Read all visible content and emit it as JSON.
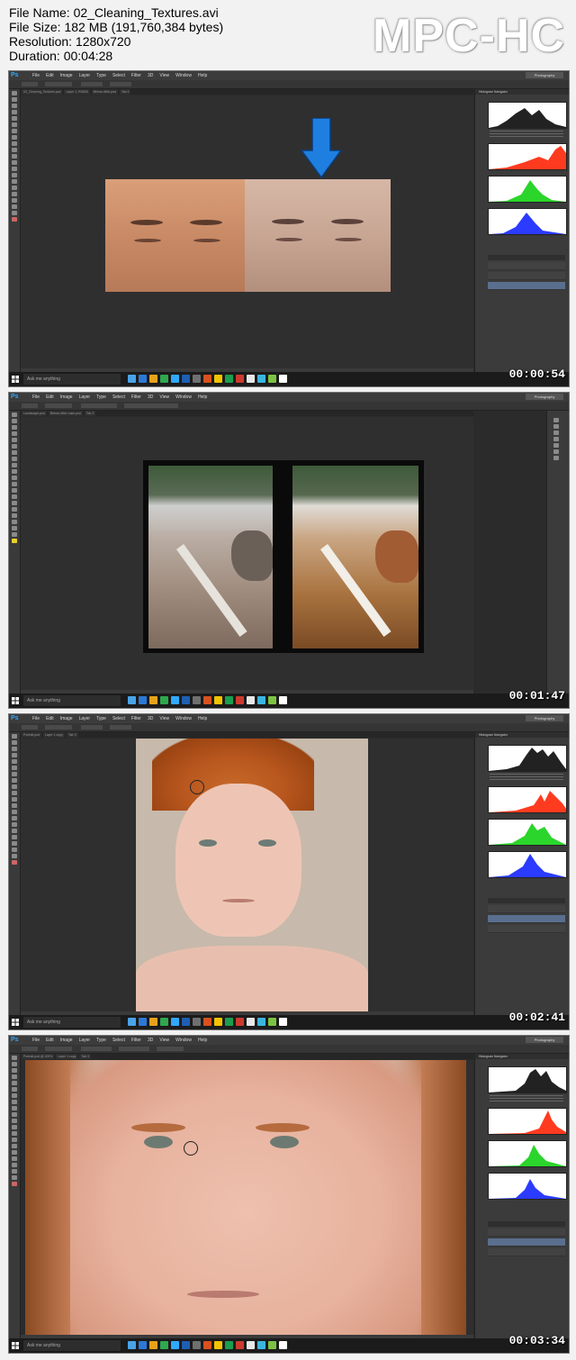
{
  "file_info": {
    "name": "File Name: 02_Cleaning_Textures.avi",
    "size": "File Size: 182 MB (191,760,384 bytes)",
    "resolution": "Resolution: 1280x720",
    "duration": "Duration: 00:04:28"
  },
  "player": {
    "logo": "MPC-HC"
  },
  "photoshop": {
    "app_icon": "Ps",
    "menus": [
      "File",
      "Edit",
      "Image",
      "Layer",
      "Type",
      "Select",
      "Filter",
      "3D",
      "View",
      "Window",
      "Help"
    ],
    "workspace": "Photography",
    "panel_tabs": "Histogram  Navigator",
    "taskbar_search_placeholder": "Ask me anything"
  },
  "frames": [
    {
      "timestamp": "00:00:54",
      "tabs": [
        "02_Cleaning_Textures.psd",
        "Layer 1, RGB/8",
        "Before-After.psd",
        "Tab 4"
      ]
    },
    {
      "timestamp": "00:01:47",
      "tabs": [
        "Landscape.psd",
        "Before-After Lake.psd",
        "Tab 3"
      ]
    },
    {
      "timestamp": "00:02:41",
      "tabs": [
        "Portrait.psd",
        "Layer 1 copy",
        "Tab 3"
      ]
    },
    {
      "timestamp": "00:03:34",
      "tabs": [
        "Portrait.psd @ 100%",
        "Layer 1 copy",
        "Tab 3"
      ]
    }
  ],
  "colors": {
    "ps_blue": "#31a8ff",
    "hist_red": "#ff3b1f",
    "hist_green": "#2bd52b",
    "hist_blue": "#2b3bff",
    "arrow_blue": "#1f7fe0",
    "taskbar": "#1b1b1b"
  }
}
